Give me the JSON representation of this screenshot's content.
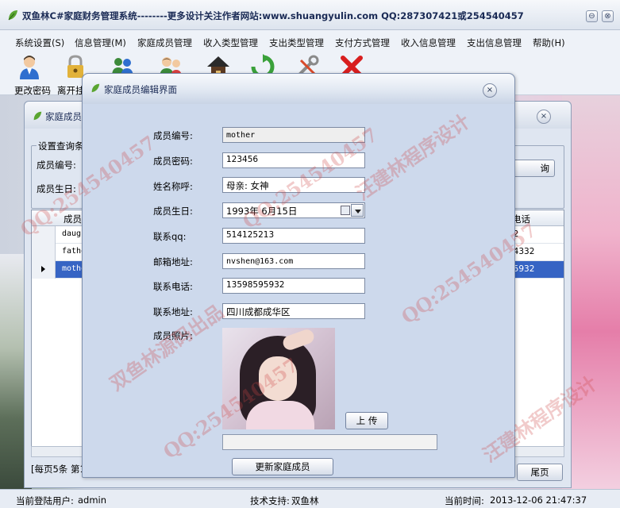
{
  "window": {
    "title": "双鱼林C#家庭财务管理系统--------更多设计关注作者网站:www.shuangyulin.com  QQ:287307421或254540457",
    "min_glyph": "⊖",
    "close_glyph": "⊗"
  },
  "menu": [
    "系统设置(S)",
    "信息管理(M)",
    "家庭成员管理",
    "收入类型管理",
    "支出类型管理",
    "支付方式管理",
    "收入信息管理",
    "支出信息管理",
    "帮助(H)"
  ],
  "toolbar": [
    {
      "label": "更改密码",
      "icon": "user-icon"
    },
    {
      "label": "离开挂",
      "icon": "lock-icon"
    },
    {
      "label": "",
      "icon": "users-icon"
    },
    {
      "label": "",
      "icon": "members-icon"
    },
    {
      "label": "",
      "icon": "home-icon"
    },
    {
      "label": "",
      "icon": "refresh-icon"
    },
    {
      "label": "",
      "icon": "tools-icon"
    },
    {
      "label": "",
      "icon": "exit-icon"
    }
  ],
  "list_window": {
    "title": "家庭成员",
    "close_glyph": "×",
    "query_group_label": "设置查询条件",
    "query_fields": [
      "成员编号:",
      "成员生日:"
    ],
    "query_button": "询",
    "columns": [
      "成员",
      "电话"
    ],
    "rows": [
      {
        "id": "daugh",
        "phone": "32"
      },
      {
        "id": "fathe",
        "phone": "94332"
      },
      {
        "id": "mothe",
        "phone": "95932"
      }
    ],
    "pager_text": "[每页5条  第1",
    "last_page": "尾页"
  },
  "dialog": {
    "title": "家庭成员编辑界面",
    "close_glyph": "×",
    "fields": {
      "member_id": {
        "label": "成员编号:",
        "value": "mother"
      },
      "password": {
        "label": "成员密码:",
        "value": "123456"
      },
      "name": {
        "label": "姓名称呼:",
        "value": "母亲: 女神"
      },
      "birthday": {
        "label": "成员生日:",
        "value": "1993年  6月15日"
      },
      "qq": {
        "label": "联系qq:",
        "value": "514125213"
      },
      "email": {
        "label": "邮箱地址:",
        "value": "nvshen@163.com"
      },
      "phone": {
        "label": "联系电话:",
        "value": "13598595932"
      },
      "address": {
        "label": "联系地址:",
        "value": "四川成都成华区"
      },
      "photo": {
        "label": "成员照片:"
      }
    },
    "upload_button": "上 传",
    "update_button": "更新家庭成员"
  },
  "status": {
    "user_label": "当前登陆用户:",
    "user": "admin",
    "support_label": "技术支持:",
    "support": "双鱼林",
    "time_label": "当前时间:",
    "time": "2013-12-06 21:47:37"
  },
  "watermarks": [
    "QQ:254540457",
    "双鱼林源码出品",
    "汪建林程序设计"
  ]
}
